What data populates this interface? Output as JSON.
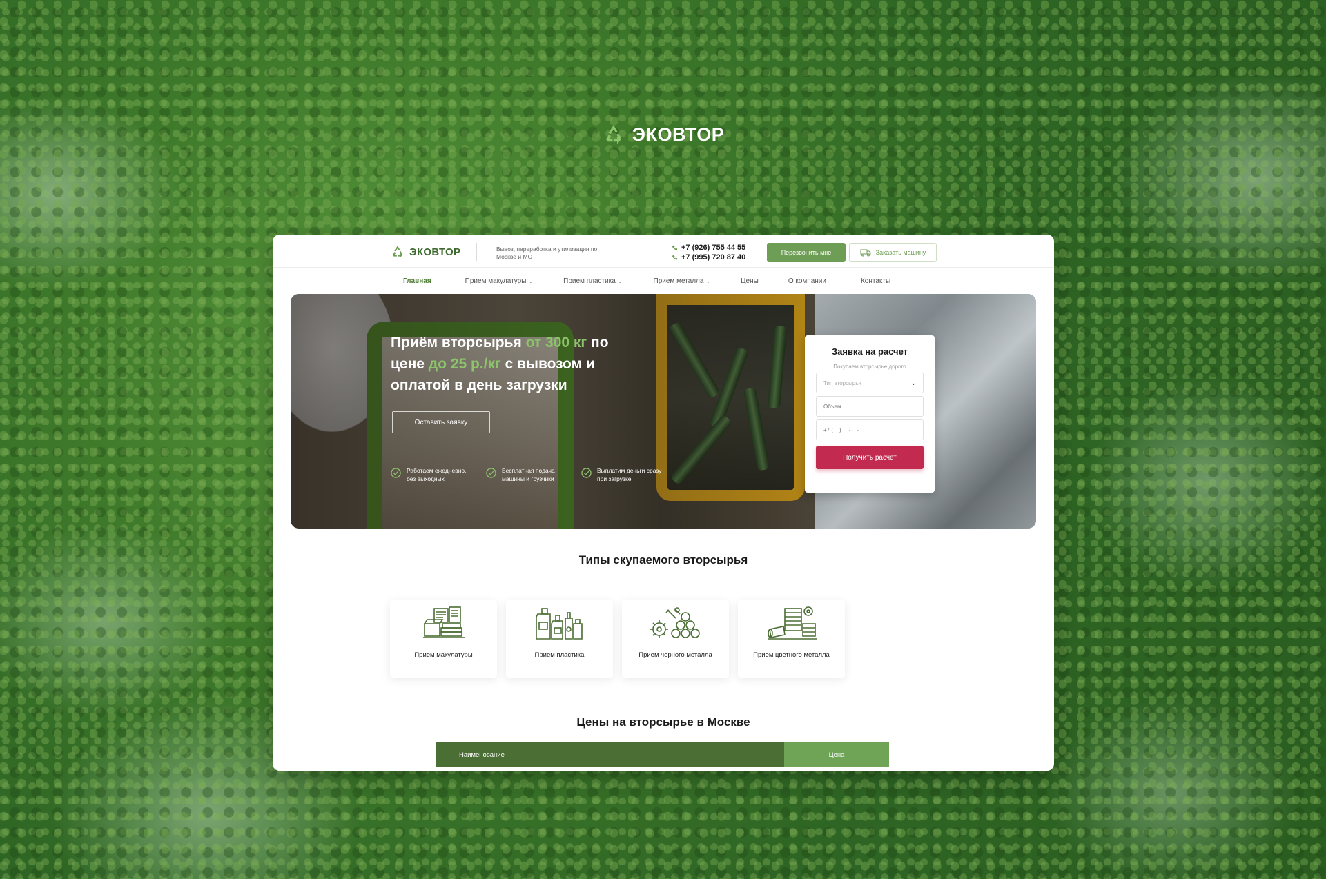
{
  "brand": {
    "name": "ЭКОВТОР",
    "accent_color": "#6e9d55"
  },
  "header": {
    "logo_text": "ЭКОВТОР",
    "tagline": "Вывоз, переработка и утилизация по Москве и МО",
    "phones": [
      "+7 (926) 755 44 55",
      "+7 (995) 720 87 40"
    ],
    "callback_label": "Перезвонить мне",
    "truck_label": "Заказать машину"
  },
  "nav": {
    "items": [
      {
        "label": "Главная",
        "active": true,
        "dropdown": false
      },
      {
        "label": "Прием макулатуры",
        "active": false,
        "dropdown": true
      },
      {
        "label": "Прием пластика",
        "active": false,
        "dropdown": true
      },
      {
        "label": "Прием металла",
        "active": false,
        "dropdown": true
      },
      {
        "label": "Цены",
        "active": false,
        "dropdown": false
      },
      {
        "label": "О компании",
        "active": false,
        "dropdown": false
      },
      {
        "label": "Контакты",
        "active": false,
        "dropdown": false
      }
    ]
  },
  "hero": {
    "title_part1": "Приём вторсырья ",
    "title_accent1": "от 300 кг",
    "title_part2": " по цене ",
    "title_accent2": "до 25 р./кг",
    "title_part3": " с вывозом и оплатой в день загрузки",
    "cta_label": "Оставить  заявку",
    "features": [
      "Работаем ежедневно, без выходных",
      "Бесплатная подача машины и грузчики",
      "Выплатим деньги сразу при загрузке"
    ]
  },
  "form": {
    "title": "Заявка на расчет",
    "subtitle": "Покупаем вторсырье дорого",
    "type_placeholder": "Тип вторсырья",
    "volume_placeholder": "Объем",
    "phone_placeholder": "+7 (__) __-__-__",
    "submit_label": "Получить расчет",
    "submit_color": "#c32a4f"
  },
  "types": {
    "title": "Типы скупаемого вторсырья",
    "items": [
      {
        "label": "Прием макулатуры",
        "icon": "paper-stack-icon"
      },
      {
        "label": "Прием пластика",
        "icon": "plastic-bottles-icon"
      },
      {
        "label": "Прием черного металла",
        "icon": "ferrous-metal-icon"
      },
      {
        "label": "Прием цветного металла",
        "icon": "nonferrous-metal-icon"
      }
    ]
  },
  "prices": {
    "title": "Цены на вторсырье в Москве",
    "col_name": "Наименование",
    "col_price": "Цена"
  }
}
